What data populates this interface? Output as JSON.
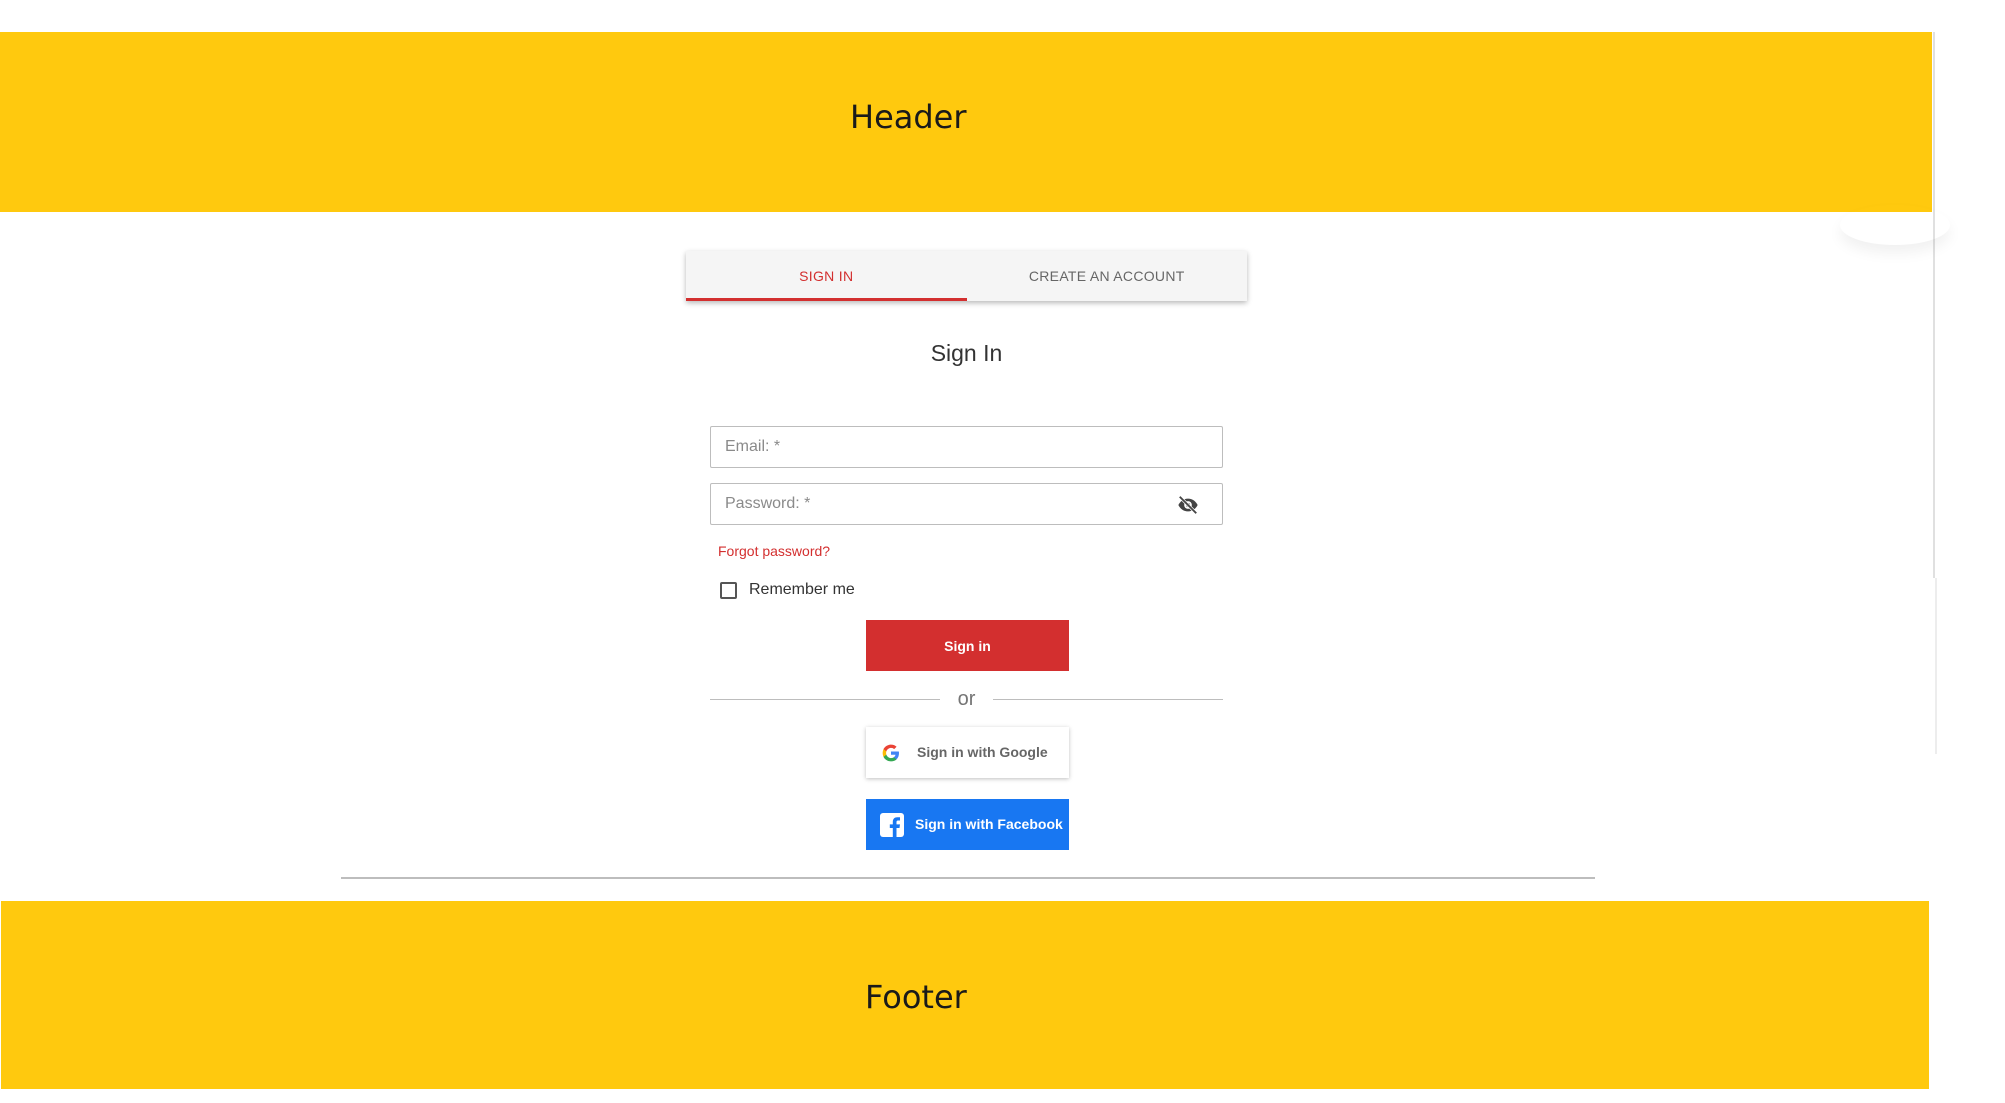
{
  "header": {
    "title": "Header"
  },
  "tabs": [
    {
      "label": "SIGN IN",
      "active": true
    },
    {
      "label": "CREATE AN ACCOUNT",
      "active": false
    }
  ],
  "form": {
    "title": "Sign In",
    "email": {
      "placeholder": "Email: *",
      "value": ""
    },
    "password": {
      "placeholder": "Password: *",
      "value": "",
      "toggle_icon": "eye-off-icon"
    },
    "forgot_password": "Forgot password?",
    "remember_me": {
      "label": "Remember me",
      "checked": false
    },
    "submit_label": "Sign in",
    "divider_text": "or"
  },
  "social": {
    "google": {
      "label": "Sign in with Google",
      "icon": "google-icon"
    },
    "facebook": {
      "label": "Sign in with Facebook",
      "icon": "facebook-icon"
    }
  },
  "footer": {
    "title": "Footer"
  },
  "colors": {
    "brand_yellow": "#ffc90e",
    "accent_red": "#d32f2f",
    "facebook_blue": "#1877f2"
  }
}
